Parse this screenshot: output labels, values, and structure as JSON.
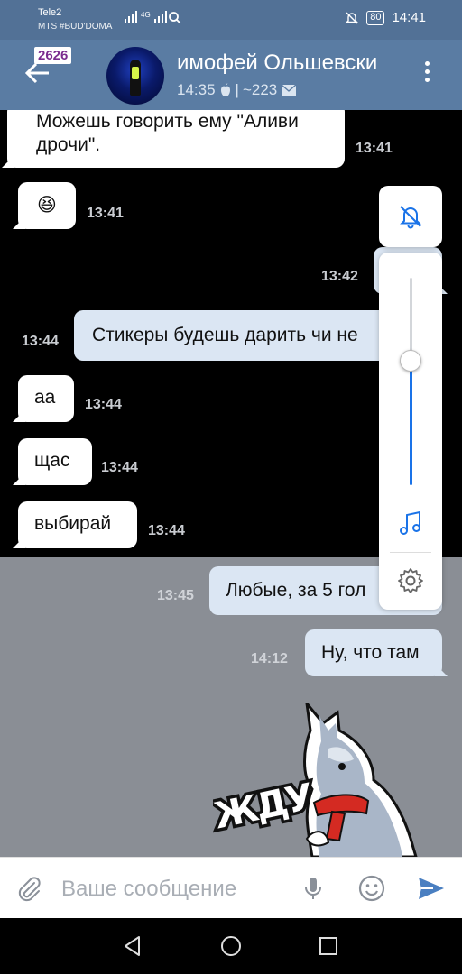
{
  "status_bar": {
    "carrier1": "Tele2",
    "carrier2": "MTS #BUD'DOMA",
    "network": "4G",
    "battery": "80",
    "clock": "14:41"
  },
  "header": {
    "badge_count": "2626",
    "title": "имофей Ольшевски",
    "last_seen": "14:35",
    "separator": "|",
    "views": "~223"
  },
  "messages": [
    {
      "dir": "in",
      "text": "Можешь говорить ему \"Аливи дрочи\".",
      "time": "13:41"
    },
    {
      "dir": "in",
      "text": "😆",
      "time": "13:41"
    },
    {
      "dir": "out",
      "text": "",
      "time": "13:42"
    },
    {
      "dir": "out",
      "text": "Стикеры будешь дарить чи не",
      "time": "13:44"
    },
    {
      "dir": "in",
      "text": "аа",
      "time": "13:44"
    },
    {
      "dir": "in",
      "text": "щас",
      "time": "13:44"
    },
    {
      "dir": "in",
      "text": "выбирай",
      "time": "13:44"
    },
    {
      "dir": "out",
      "text": "Любые, за 5 гол",
      "time": "13:45"
    },
    {
      "dir": "out",
      "text": "Ну, что там",
      "time": "14:12"
    }
  ],
  "sticker": {
    "caption": "ЖДУ"
  },
  "volume_panel": {
    "level": 0.6
  },
  "input": {
    "placeholder": "Ваше сообщение"
  },
  "icons": {
    "back": "arrow-left-icon",
    "menu": "more-vertical-icon",
    "attach": "paperclip-icon",
    "mic": "microphone-icon",
    "emoji": "smile-icon",
    "send": "send-icon",
    "mute": "bell-off-icon",
    "music": "music-note-icon",
    "settings": "gear-icon"
  },
  "colors": {
    "header": "#5a7ca3",
    "status_bar": "#527196",
    "outgoing_bubble": "#dbe6f3",
    "accent": "#1a73e8",
    "send": "#4a7fc1"
  }
}
